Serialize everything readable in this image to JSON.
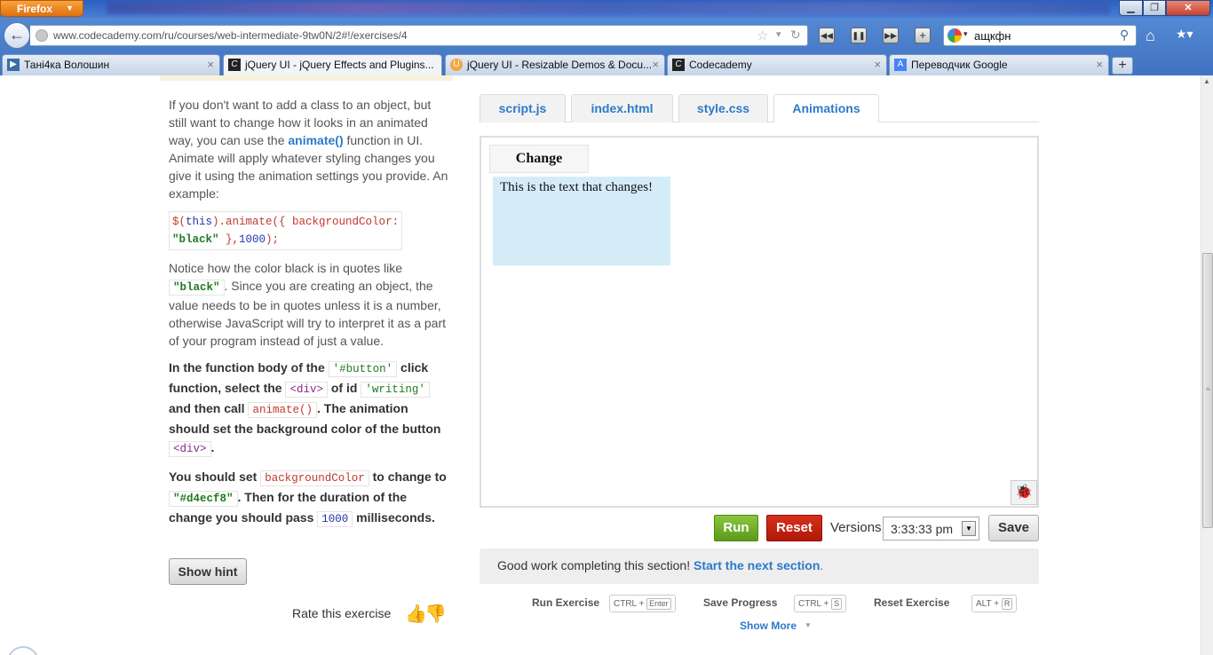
{
  "browser": {
    "app_button": "Firefox",
    "url": "www.codecademy.com/ru/courses/web-intermediate-9tw0N/2#!/exercises/4",
    "search_query": "ащкфн",
    "tabs": [
      {
        "title": "Тані4ка Волошин",
        "icon": "play-icon"
      },
      {
        "title": "jQuery UI - jQuery Effects and Plugins...",
        "icon": "codecademy-icon"
      },
      {
        "title": "jQuery UI - Resizable Demos & Docu...",
        "icon": "jquery-ui-icon"
      },
      {
        "title": "Codecademy",
        "icon": "codecademy-icon"
      },
      {
        "title": "Переводчик Google",
        "icon": "translate-icon"
      }
    ]
  },
  "lesson": {
    "p1_a": "If you don't want to add a class to an object, but still want to change how it looks in an animated way, you can use the ",
    "p1_link": "animate()",
    "p1_b": " function in UI. Animate will apply whatever styling changes you give it using the animation settings you provide. An example:",
    "code_1": "$(this).animate({ backgroundColor:",
    "code_2": "\"black\" },1000);",
    "p2_a": "Notice how the color black is in quotes like ",
    "p2_code": "\"black\"",
    "p2_b": ". Since you are creating an object, the value needs to be in quotes unless it is a number, otherwise JavaScript will try to interpret it as a part of your program instead of just a value.",
    "i1_a": "In the function body of the ",
    "i1_code_button": "'#button'",
    "i1_b": " click function, select the ",
    "i1_code_div": "<div>",
    "i1_c": " of id ",
    "i1_code_writing": "'writing'",
    "i1_d": " and then call ",
    "i1_code_animate": "animate()",
    "i1_e": ". The animation should set the background color of the button ",
    "i1_code_div2": "<div>",
    "i1_f": ".",
    "i2_a": "You should set ",
    "i2_code_bg": "backgroundColor",
    "i2_b": " to change to ",
    "i2_code_color": "\"#d4ecf8\"",
    "i2_c": ". Then for the duration of the change you should pass ",
    "i2_code_ms": "1000",
    "i2_d": " milliseconds.",
    "hint_button": "Show hint",
    "rate_label": "Rate this exercise"
  },
  "editor": {
    "tabs": [
      "script.js",
      "index.html",
      "style.css",
      "Animations"
    ],
    "active_tab": "Animations",
    "preview_button": "Change",
    "preview_text": "This is the text that changes!",
    "preview_box_color": "#d4ecf8",
    "run": "Run",
    "reset": "Reset",
    "versions_label": "Versions",
    "version_value": "3:33:33 pm",
    "save": "Save"
  },
  "banner": {
    "text": "Good work completing this section! ",
    "link": "Start the next section",
    "period": "."
  },
  "shortcuts": {
    "run_label": "Run Exercise",
    "run_mod": "CTRL + ",
    "run_key": "Enter",
    "save_label": "Save Progress",
    "save_mod": "CTRL + ",
    "save_key": "S",
    "reset_label": "Reset Exercise",
    "reset_mod": "ALT + ",
    "reset_key": "R",
    "show_more": "Show More"
  },
  "colors": {
    "link": "#2d7ac8",
    "run": "#6aa82a",
    "reset": "#c82010",
    "firefox_orange": "#e87a16"
  }
}
